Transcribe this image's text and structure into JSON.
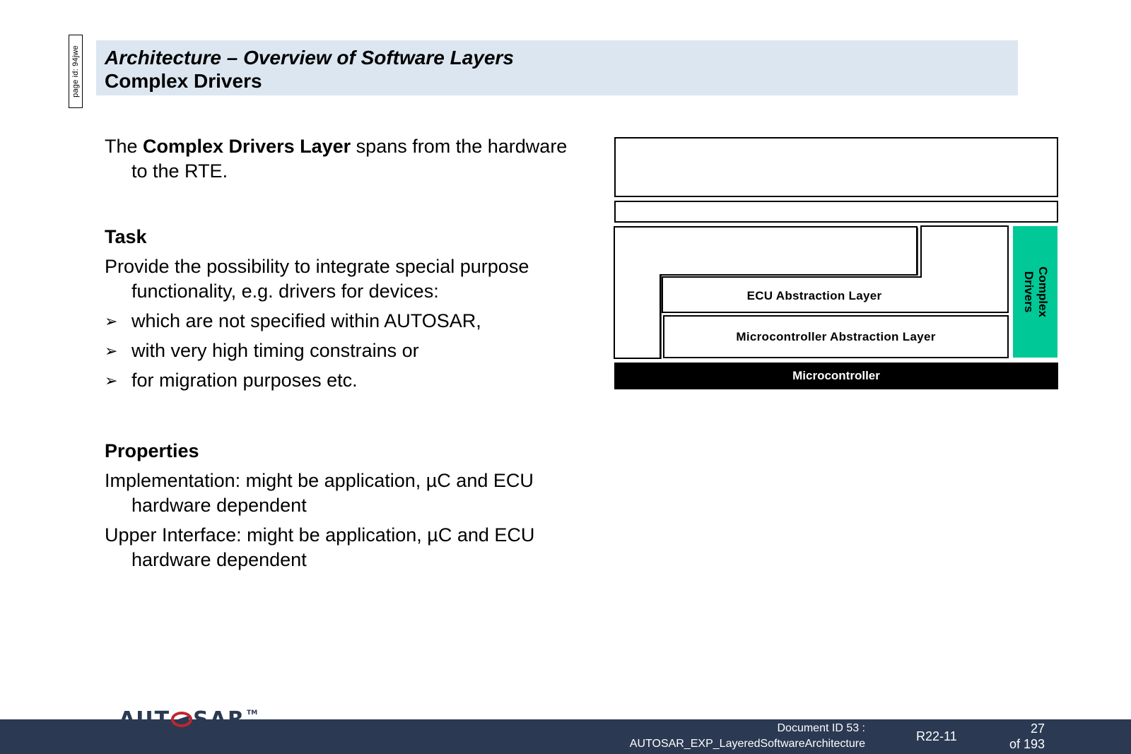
{
  "page_id": "page id: 94jwe",
  "header": {
    "title": "Architecture – Overview of Software Layers",
    "subtitle": "Complex Drivers"
  },
  "body": {
    "intro": {
      "pre": "The ",
      "bold": "Complex Drivers Layer",
      "post": " spans from the hardware to the RTE."
    },
    "task_heading": "Task",
    "task_text": "Provide the possibility to integrate special purpose functionality, e.g. drivers for devices:",
    "bullets": [
      "which are not specified within AUTOSAR,",
      "with very high timing constrains or",
      "for migration purposes etc."
    ],
    "properties_heading": "Properties",
    "properties": [
      "Implementation: might be application, µC and ECU hardware dependent",
      "Upper Interface: might be application, µC and ECU hardware dependent"
    ]
  },
  "diagram": {
    "ecu_abstraction": "ECU Abstraction Layer",
    "mcal": "Microcontroller Abstraction Layer",
    "microcontroller": "Microcontroller",
    "complex_drivers": "Complex\nDrivers",
    "complex_drivers_color": "#00c896"
  },
  "footer": {
    "logo": "AUTOSAR",
    "logo_accent_color": "#c0262d",
    "bar_color": "#2b3a52",
    "doc_id_line1": "Document ID 53 :",
    "doc_id_line2": "AUTOSAR_EXP_LayeredSoftwareArchitecture",
    "release": "R22-11",
    "page_number": "27",
    "page_total": "of 193"
  }
}
